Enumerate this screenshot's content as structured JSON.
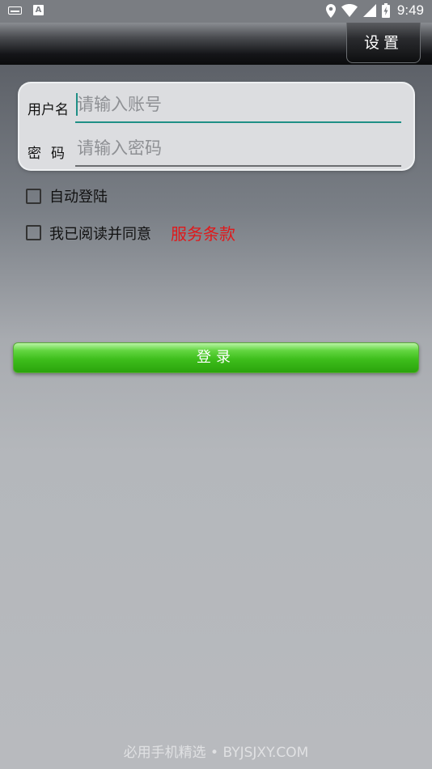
{
  "status_bar": {
    "time": "9:49",
    "left_icons": [
      "keyboard-icon",
      "a-notification-icon"
    ],
    "right_icons": [
      "location-icon",
      "wifi-icon",
      "signal-icon",
      "battery-charging-icon"
    ],
    "a_icon_glyph": "A"
  },
  "title_bar": {
    "settings_label": "设置"
  },
  "login_form": {
    "username_label": "用户名",
    "username_placeholder": "请输入账号",
    "username_value": "",
    "password_label": "密码",
    "password_placeholder": "请输入密码",
    "password_value": ""
  },
  "options": {
    "auto_login_label": "自动登陆",
    "auto_login_checked": false,
    "agree_label": "我已阅读并同意",
    "agree_checked": false,
    "terms_link": "服务条款"
  },
  "login_button": {
    "label": "登录"
  },
  "watermark": {
    "text": "必用手机精选 • BYJSJXY.COM"
  },
  "colors": {
    "accent_teal": "#1f8f86",
    "terms_red": "#e0191b",
    "button_green": "#3ebe1c"
  }
}
